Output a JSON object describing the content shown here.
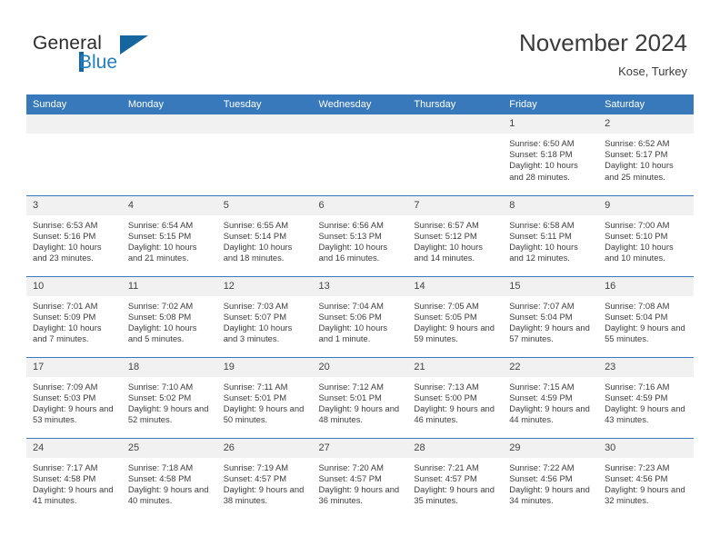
{
  "brand": {
    "name_part1": "General",
    "name_part2": "Blue",
    "logo_icon": "triangle-flag-icon"
  },
  "header": {
    "title": "November 2024",
    "location": "Kose, Turkey"
  },
  "colors": {
    "header_blue": "#3879bc",
    "brand_blue": "#1f7fc4",
    "logo_dark_blue": "#15659e",
    "daynum_band": "#f1f1f1",
    "text": "#3d3d3d"
  },
  "calendar": {
    "weekday_headers": [
      "Sunday",
      "Monday",
      "Tuesday",
      "Wednesday",
      "Thursday",
      "Friday",
      "Saturday"
    ],
    "weeks": [
      [
        {
          "day": "",
          "sunrise": "",
          "sunset": "",
          "daylight": "",
          "empty": true
        },
        {
          "day": "",
          "sunrise": "",
          "sunset": "",
          "daylight": "",
          "empty": true
        },
        {
          "day": "",
          "sunrise": "",
          "sunset": "",
          "daylight": "",
          "empty": true
        },
        {
          "day": "",
          "sunrise": "",
          "sunset": "",
          "daylight": "",
          "empty": true
        },
        {
          "day": "",
          "sunrise": "",
          "sunset": "",
          "daylight": "",
          "empty": true
        },
        {
          "day": "1",
          "sunrise": "Sunrise: 6:50 AM",
          "sunset": "Sunset: 5:18 PM",
          "daylight": "Daylight: 10 hours and 28 minutes."
        },
        {
          "day": "2",
          "sunrise": "Sunrise: 6:52 AM",
          "sunset": "Sunset: 5:17 PM",
          "daylight": "Daylight: 10 hours and 25 minutes."
        }
      ],
      [
        {
          "day": "3",
          "sunrise": "Sunrise: 6:53 AM",
          "sunset": "Sunset: 5:16 PM",
          "daylight": "Daylight: 10 hours and 23 minutes."
        },
        {
          "day": "4",
          "sunrise": "Sunrise: 6:54 AM",
          "sunset": "Sunset: 5:15 PM",
          "daylight": "Daylight: 10 hours and 21 minutes."
        },
        {
          "day": "5",
          "sunrise": "Sunrise: 6:55 AM",
          "sunset": "Sunset: 5:14 PM",
          "daylight": "Daylight: 10 hours and 18 minutes."
        },
        {
          "day": "6",
          "sunrise": "Sunrise: 6:56 AM",
          "sunset": "Sunset: 5:13 PM",
          "daylight": "Daylight: 10 hours and 16 minutes."
        },
        {
          "day": "7",
          "sunrise": "Sunrise: 6:57 AM",
          "sunset": "Sunset: 5:12 PM",
          "daylight": "Daylight: 10 hours and 14 minutes."
        },
        {
          "day": "8",
          "sunrise": "Sunrise: 6:58 AM",
          "sunset": "Sunset: 5:11 PM",
          "daylight": "Daylight: 10 hours and 12 minutes."
        },
        {
          "day": "9",
          "sunrise": "Sunrise: 7:00 AM",
          "sunset": "Sunset: 5:10 PM",
          "daylight": "Daylight: 10 hours and 10 minutes."
        }
      ],
      [
        {
          "day": "10",
          "sunrise": "Sunrise: 7:01 AM",
          "sunset": "Sunset: 5:09 PM",
          "daylight": "Daylight: 10 hours and 7 minutes."
        },
        {
          "day": "11",
          "sunrise": "Sunrise: 7:02 AM",
          "sunset": "Sunset: 5:08 PM",
          "daylight": "Daylight: 10 hours and 5 minutes."
        },
        {
          "day": "12",
          "sunrise": "Sunrise: 7:03 AM",
          "sunset": "Sunset: 5:07 PM",
          "daylight": "Daylight: 10 hours and 3 minutes."
        },
        {
          "day": "13",
          "sunrise": "Sunrise: 7:04 AM",
          "sunset": "Sunset: 5:06 PM",
          "daylight": "Daylight: 10 hours and 1 minute."
        },
        {
          "day": "14",
          "sunrise": "Sunrise: 7:05 AM",
          "sunset": "Sunset: 5:05 PM",
          "daylight": "Daylight: 9 hours and 59 minutes."
        },
        {
          "day": "15",
          "sunrise": "Sunrise: 7:07 AM",
          "sunset": "Sunset: 5:04 PM",
          "daylight": "Daylight: 9 hours and 57 minutes."
        },
        {
          "day": "16",
          "sunrise": "Sunrise: 7:08 AM",
          "sunset": "Sunset: 5:04 PM",
          "daylight": "Daylight: 9 hours and 55 minutes."
        }
      ],
      [
        {
          "day": "17",
          "sunrise": "Sunrise: 7:09 AM",
          "sunset": "Sunset: 5:03 PM",
          "daylight": "Daylight: 9 hours and 53 minutes."
        },
        {
          "day": "18",
          "sunrise": "Sunrise: 7:10 AM",
          "sunset": "Sunset: 5:02 PM",
          "daylight": "Daylight: 9 hours and 52 minutes."
        },
        {
          "day": "19",
          "sunrise": "Sunrise: 7:11 AM",
          "sunset": "Sunset: 5:01 PM",
          "daylight": "Daylight: 9 hours and 50 minutes."
        },
        {
          "day": "20",
          "sunrise": "Sunrise: 7:12 AM",
          "sunset": "Sunset: 5:01 PM",
          "daylight": "Daylight: 9 hours and 48 minutes."
        },
        {
          "day": "21",
          "sunrise": "Sunrise: 7:13 AM",
          "sunset": "Sunset: 5:00 PM",
          "daylight": "Daylight: 9 hours and 46 minutes."
        },
        {
          "day": "22",
          "sunrise": "Sunrise: 7:15 AM",
          "sunset": "Sunset: 4:59 PM",
          "daylight": "Daylight: 9 hours and 44 minutes."
        },
        {
          "day": "23",
          "sunrise": "Sunrise: 7:16 AM",
          "sunset": "Sunset: 4:59 PM",
          "daylight": "Daylight: 9 hours and 43 minutes."
        }
      ],
      [
        {
          "day": "24",
          "sunrise": "Sunrise: 7:17 AM",
          "sunset": "Sunset: 4:58 PM",
          "daylight": "Daylight: 9 hours and 41 minutes."
        },
        {
          "day": "25",
          "sunrise": "Sunrise: 7:18 AM",
          "sunset": "Sunset: 4:58 PM",
          "daylight": "Daylight: 9 hours and 40 minutes."
        },
        {
          "day": "26",
          "sunrise": "Sunrise: 7:19 AM",
          "sunset": "Sunset: 4:57 PM",
          "daylight": "Daylight: 9 hours and 38 minutes."
        },
        {
          "day": "27",
          "sunrise": "Sunrise: 7:20 AM",
          "sunset": "Sunset: 4:57 PM",
          "daylight": "Daylight: 9 hours and 36 minutes."
        },
        {
          "day": "28",
          "sunrise": "Sunrise: 7:21 AM",
          "sunset": "Sunset: 4:57 PM",
          "daylight": "Daylight: 9 hours and 35 minutes."
        },
        {
          "day": "29",
          "sunrise": "Sunrise: 7:22 AM",
          "sunset": "Sunset: 4:56 PM",
          "daylight": "Daylight: 9 hours and 34 minutes."
        },
        {
          "day": "30",
          "sunrise": "Sunrise: 7:23 AM",
          "sunset": "Sunset: 4:56 PM",
          "daylight": "Daylight: 9 hours and 32 minutes."
        }
      ]
    ]
  }
}
